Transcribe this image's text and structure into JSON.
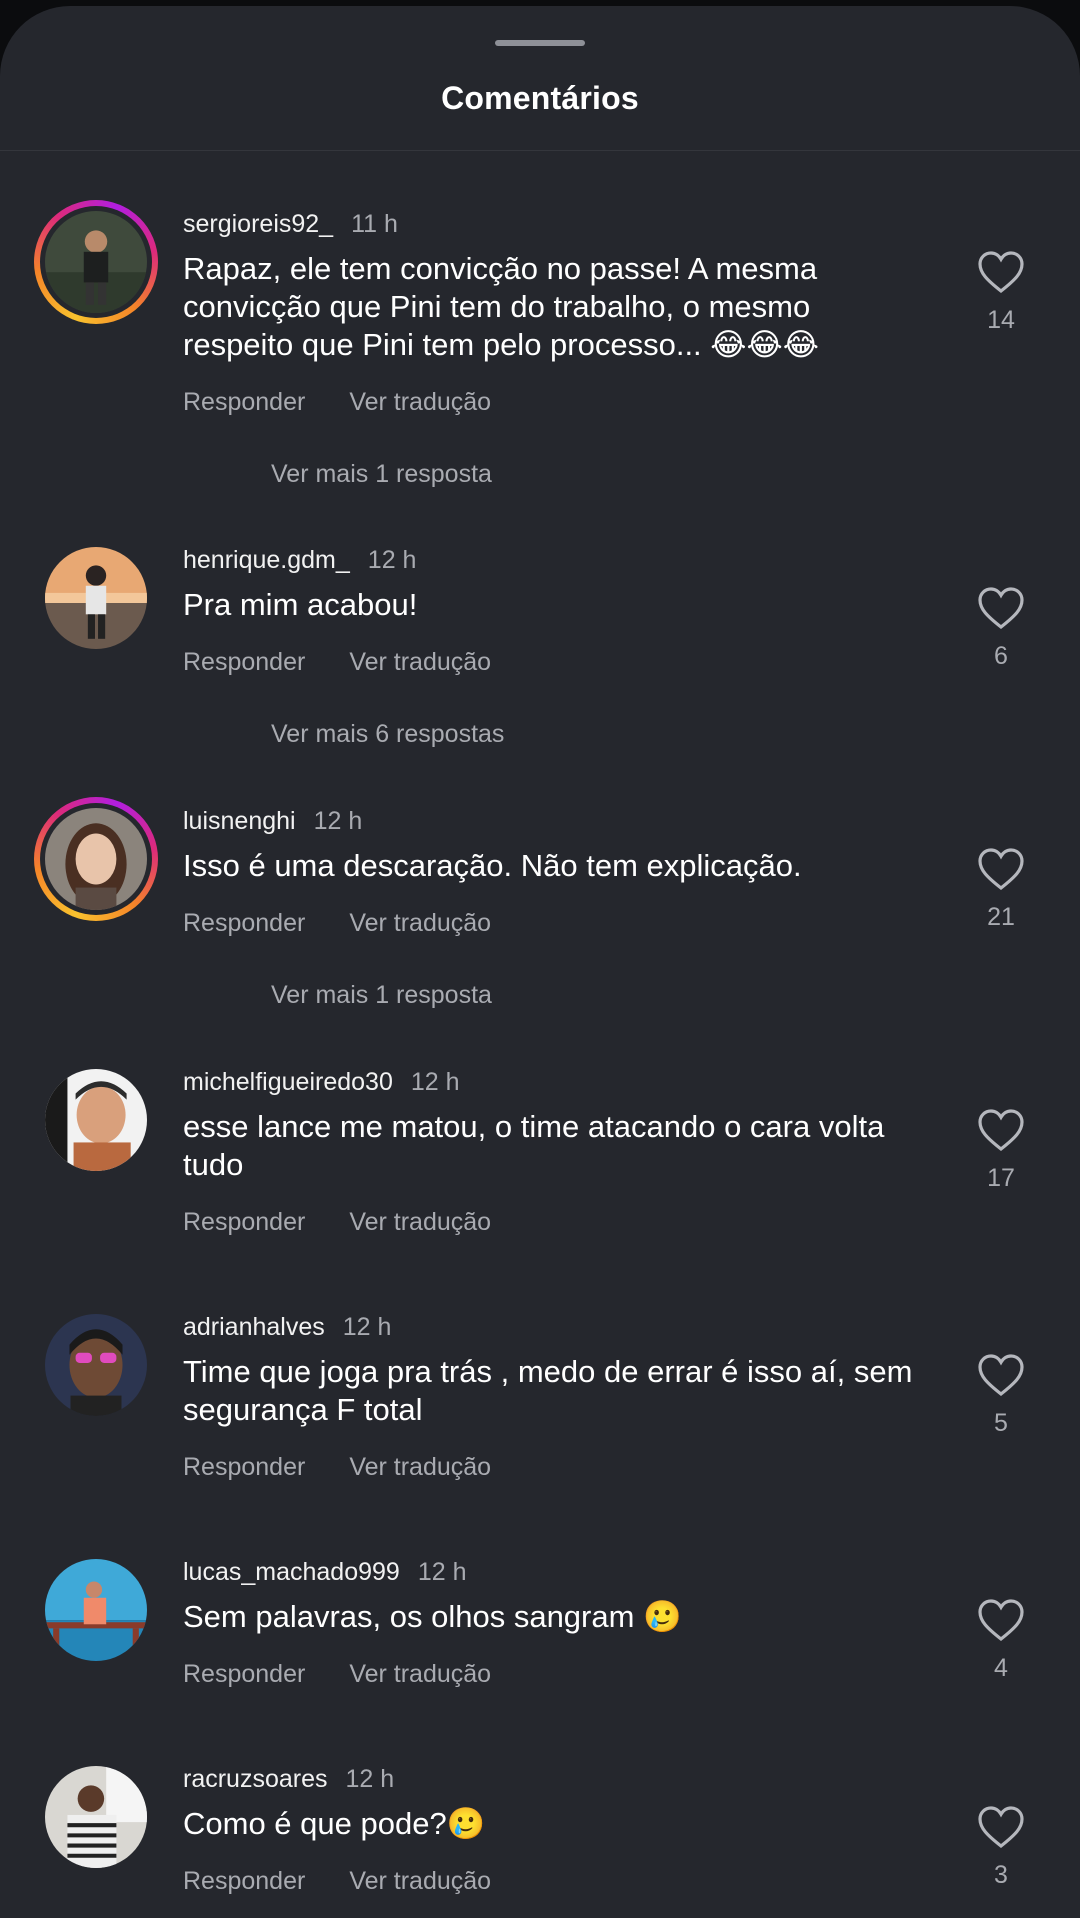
{
  "header": {
    "title": "Comentários"
  },
  "comments": [
    {
      "username": "sergioreis92_",
      "time": "11 h",
      "text": "Rapaz, ele tem convicção no passe! A mesma convicção que Pini tem do trabalho, o mesmo respeito que Pini tem pelo processo... 😂😂😂",
      "reply": "Responder",
      "translate": "Ver tradução",
      "likes": "14",
      "more_replies": "Ver mais 1 resposta"
    },
    {
      "username": "henrique.gdm_",
      "time": "12 h",
      "text": "Pra mim acabou!",
      "reply": "Responder",
      "translate": "Ver tradução",
      "likes": "6",
      "more_replies": "Ver mais 6 respostas"
    },
    {
      "username": "luisnenghi",
      "time": "12 h",
      "text": "Isso é uma descaração. Não tem explicação.",
      "reply": "Responder",
      "translate": "Ver tradução",
      "likes": "21",
      "more_replies": "Ver mais 1 resposta"
    },
    {
      "username": "michelfigueiredo30",
      "time": "12 h",
      "text": "esse lance me matou, o time atacando o cara volta tudo",
      "reply": "Responder",
      "translate": "Ver tradução",
      "likes": "17"
    },
    {
      "username": "adrianhalves",
      "time": "12 h",
      "text": "Time que joga pra trás , medo de errar é isso aí, sem segurança F total",
      "reply": "Responder",
      "translate": "Ver tradução",
      "likes": "5"
    },
    {
      "username": "lucas_machado999",
      "time": "12 h",
      "text": "Sem palavras, os olhos sangram 🥲",
      "reply": "Responder",
      "translate": "Ver tradução",
      "likes": "4"
    },
    {
      "username": "racruzsoares",
      "time": "12 h",
      "text": "Como é que pode?🥲",
      "reply": "Responder",
      "translate": "Ver tradução",
      "likes": "3"
    }
  ]
}
